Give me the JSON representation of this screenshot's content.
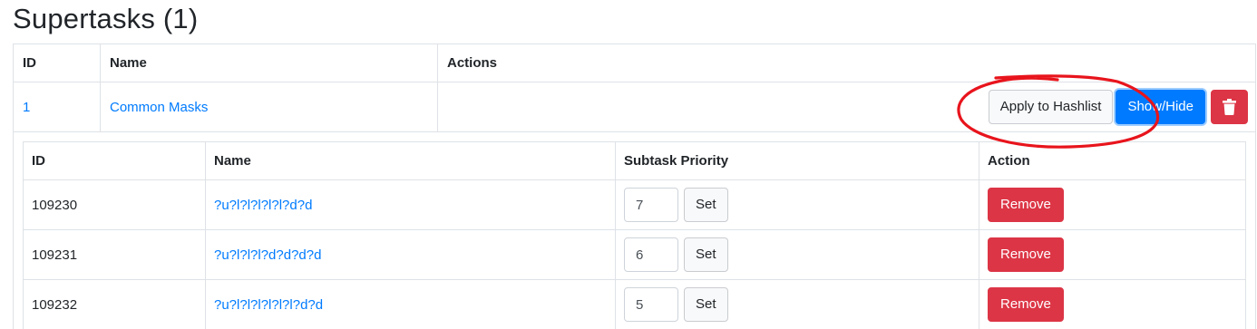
{
  "page": {
    "title": "Supertasks (1)"
  },
  "supertasks": {
    "headers": {
      "id": "ID",
      "name": "Name",
      "actions": "Actions"
    },
    "row": {
      "id": "1",
      "name": "Common Masks",
      "apply_label": "Apply to Hashlist",
      "showhide_label": "Show/Hide",
      "delete_icon": "trash-icon"
    }
  },
  "subtasks": {
    "headers": {
      "id": "ID",
      "name": "Name",
      "priority": "Subtask Priority",
      "action": "Action"
    },
    "set_label": "Set",
    "remove_label": "Remove",
    "rows": [
      {
        "id": "109230",
        "name": "?u?l?l?l?l?l?d?d",
        "priority": "7"
      },
      {
        "id": "109231",
        "name": "?u?l?l?l?d?d?d?d",
        "priority": "6"
      },
      {
        "id": "109232",
        "name": "?u?l?l?l?l?l?l?d?d",
        "priority": "5"
      }
    ]
  },
  "colors": {
    "link": "#007bff",
    "primary": "#007bff",
    "danger": "#dc3545",
    "annotation": "#e8141c"
  }
}
